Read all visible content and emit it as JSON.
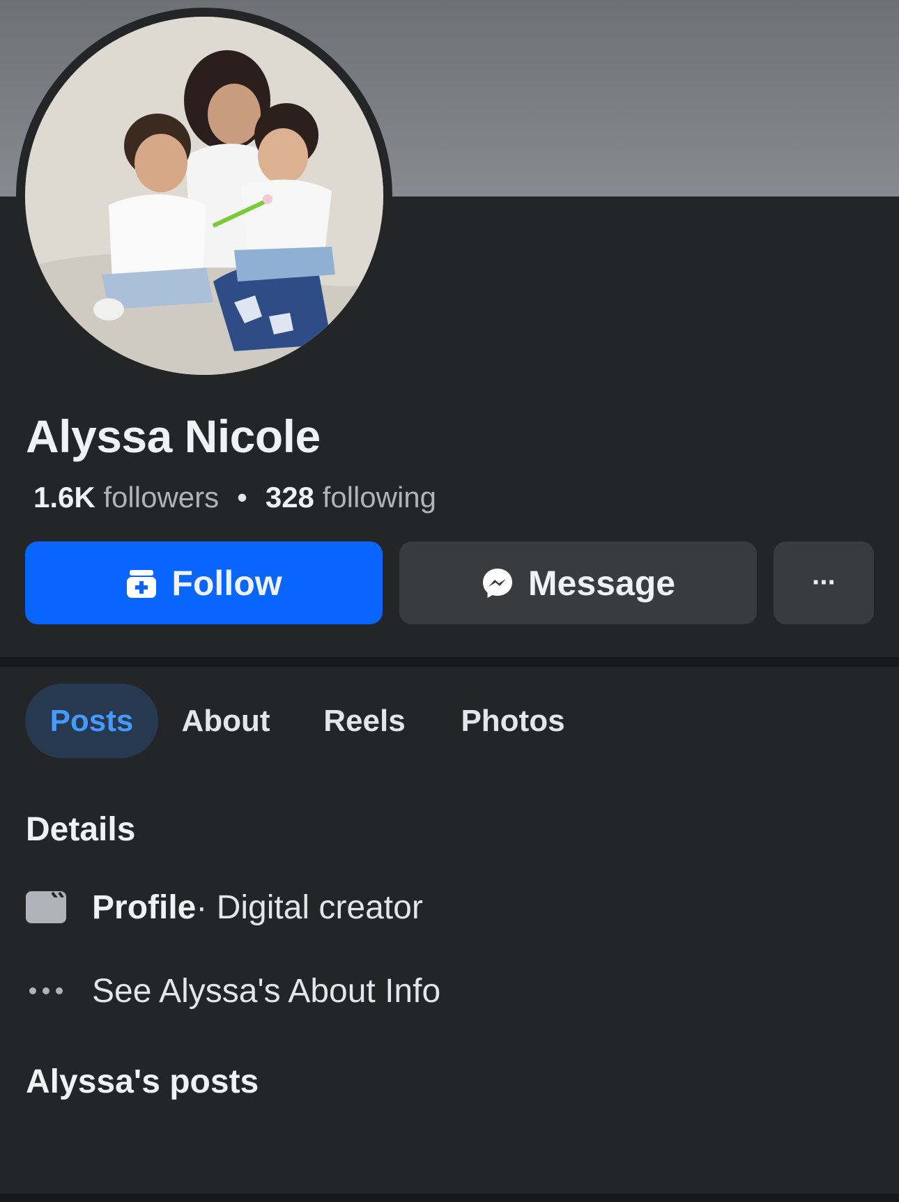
{
  "profile": {
    "name": "Alyssa Nicole",
    "followers_count": "1.6K",
    "followers_label": "followers",
    "separator": "•",
    "following_count": "328",
    "following_label": "following"
  },
  "actions": {
    "follow_label": "Follow",
    "message_label": "Message",
    "more_label": "···"
  },
  "tabs": [
    {
      "label": "Posts",
      "active": true
    },
    {
      "label": "About",
      "active": false
    },
    {
      "label": "Reels",
      "active": false
    },
    {
      "label": "Photos",
      "active": false
    }
  ],
  "details": {
    "heading": "Details",
    "category_title": "Profile",
    "category_value": " · Digital creator",
    "about_link": "See Alyssa's About Info"
  },
  "posts": {
    "heading": "Alyssa's posts"
  },
  "icons": {
    "follow": "follow-icon",
    "message": "messenger-icon",
    "more": "more-icon",
    "profile": "clapperboard-icon",
    "about": "more-dots-icon"
  },
  "colors": {
    "accent": "#0866ff",
    "active_tab_bg": "#263951",
    "active_tab_text": "#4599ff",
    "background": "#242527"
  }
}
